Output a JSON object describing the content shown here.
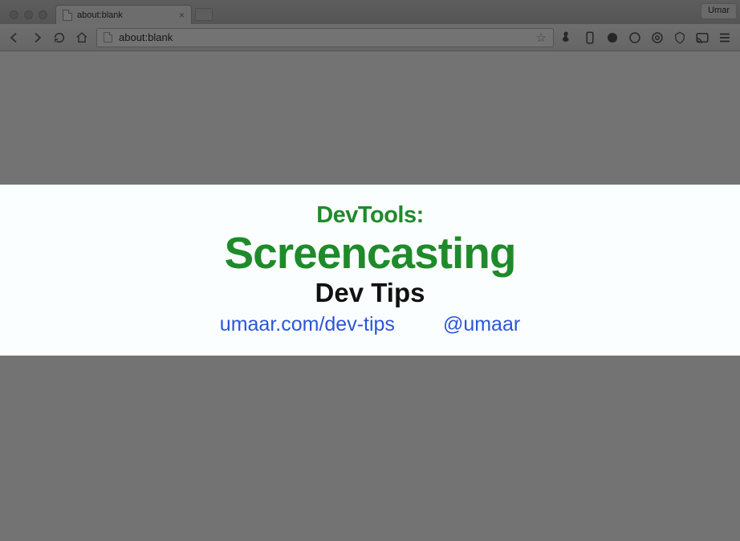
{
  "window": {
    "profile_name": "Umar"
  },
  "tab": {
    "title": "about:blank"
  },
  "omnibox": {
    "url_display": "about:blank"
  },
  "card": {
    "line1": "DevTools:",
    "line2": "Screencasting",
    "line3": "Dev Tips",
    "link_site": "umaar.com/dev-tips",
    "link_handle": "@umaar"
  }
}
